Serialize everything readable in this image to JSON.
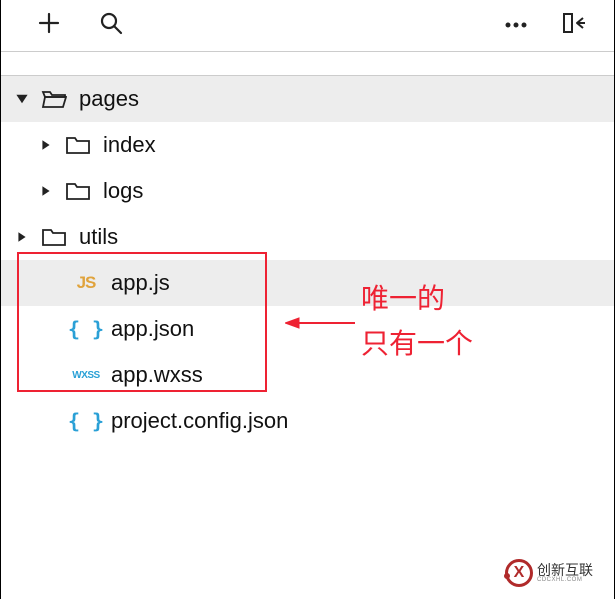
{
  "toolbar": {
    "add_icon": "plus",
    "search_icon": "search",
    "more_icon": "more",
    "collapse_icon": "collapse-panel"
  },
  "tree": {
    "items": [
      {
        "name": "pages",
        "type": "folder",
        "expanded": true,
        "selected": true,
        "indent": 0
      },
      {
        "name": "index",
        "type": "folder",
        "expanded": false,
        "selected": false,
        "indent": 1
      },
      {
        "name": "logs",
        "type": "folder",
        "expanded": false,
        "selected": false,
        "indent": 1
      },
      {
        "name": "utils",
        "type": "folder",
        "expanded": false,
        "selected": false,
        "indent": 0
      },
      {
        "name": "app.js",
        "type": "file-js",
        "selected": true,
        "indent": 2
      },
      {
        "name": "app.json",
        "type": "file-json",
        "selected": false,
        "indent": 2
      },
      {
        "name": "app.wxss",
        "type": "file-wxss",
        "selected": false,
        "indent": 2
      },
      {
        "name": "project.config.json",
        "type": "file-json",
        "selected": false,
        "indent": 2
      }
    ]
  },
  "annotation": {
    "line1": "唯一的",
    "line2": "只有一个",
    "box_color": "#ee2233",
    "highlighted_files": [
      "app.js",
      "app.json",
      "app.wxss"
    ]
  },
  "watermark": {
    "brand": "创新互联",
    "sub": "CDCXHL.COM"
  }
}
